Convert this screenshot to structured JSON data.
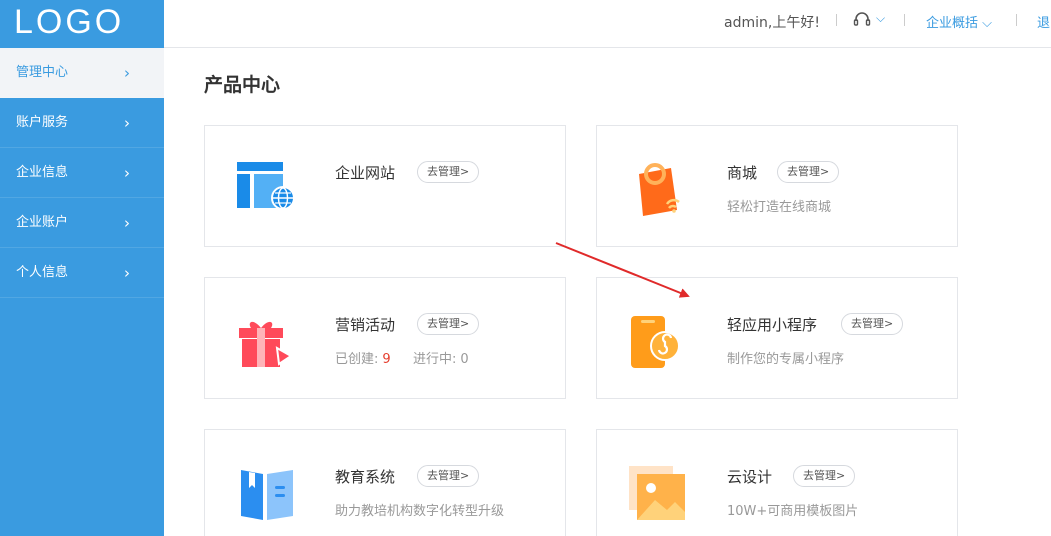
{
  "logo": "LOGO",
  "sidebar": {
    "items": [
      {
        "label": "管理中心"
      },
      {
        "label": "账户服务"
      },
      {
        "label": "企业信息"
      },
      {
        "label": "企业账户"
      },
      {
        "label": "个人信息"
      }
    ],
    "chevron": "›"
  },
  "header": {
    "greeting": "admin,上午好!",
    "help_chevron": "⌵",
    "overview_label": "企业概括 ⌵",
    "logout_label": "退"
  },
  "main": {
    "title": "产品中心",
    "manage_label": "去管理>",
    "cards": [
      {
        "name": "企业网站",
        "desc": ""
      },
      {
        "name": "商城",
        "desc": "轻松打造在线商城"
      },
      {
        "name": "营销活动",
        "created_label": "已创建:",
        "created_value": "9",
        "ongoing_label": "进行中:",
        "ongoing_value": "0"
      },
      {
        "name": "轻应用小程序",
        "desc": "制作您的专属小程序"
      },
      {
        "name": "教育系统",
        "desc": "助力教培机构数字化转型升级"
      },
      {
        "name": "云设计",
        "desc": "10W+可商用模板图片"
      }
    ]
  },
  "colors": {
    "sidebar": "#3a9be0",
    "link": "#3a9be0",
    "annotation_arrow": "#e02a2a",
    "count_highlight": "#e53d2d"
  }
}
